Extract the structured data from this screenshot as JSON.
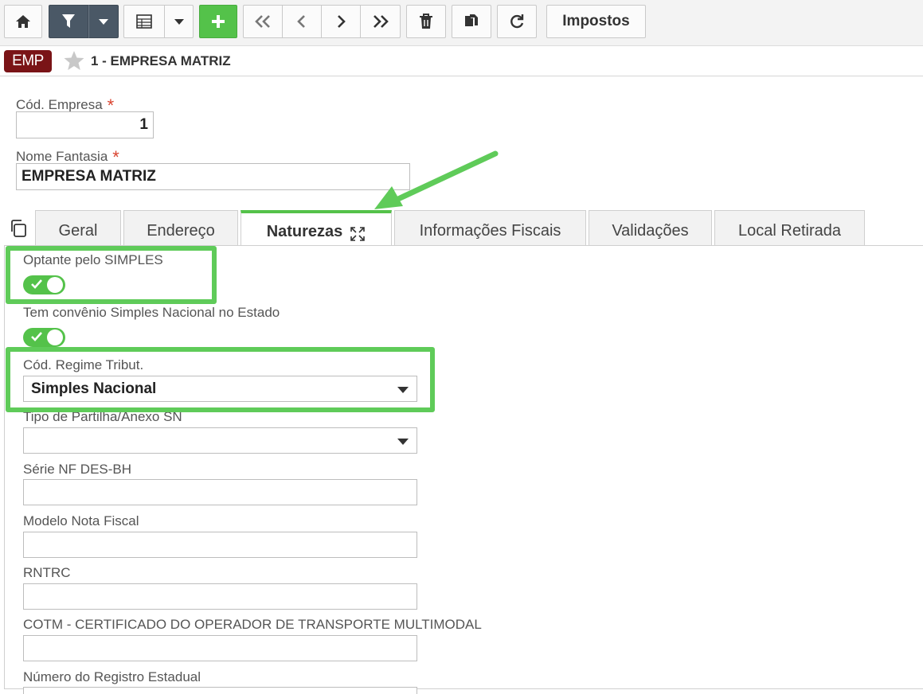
{
  "toolbar": {
    "buttons": [
      {
        "name": "home-button",
        "icon": "home-icon"
      },
      {
        "name": "filter-button",
        "icon": "filter-icon"
      },
      {
        "name": "filter-dropdown-button",
        "icon": "caret-down-icon"
      },
      {
        "name": "grid-view-button",
        "icon": "table-icon"
      },
      {
        "name": "grid-dropdown-button",
        "icon": "caret-down-icon"
      },
      {
        "name": "add-button",
        "icon": "plus-icon"
      },
      {
        "name": "first-record-button",
        "icon": "double-chevron-left-icon"
      },
      {
        "name": "previous-record-button",
        "icon": "chevron-left-icon"
      },
      {
        "name": "next-record-button",
        "icon": "chevron-right-icon"
      },
      {
        "name": "last-record-button",
        "icon": "double-chevron-right-icon"
      },
      {
        "name": "delete-button",
        "icon": "trash-icon"
      },
      {
        "name": "duplicate-button",
        "icon": "copy-icon"
      },
      {
        "name": "refresh-button",
        "icon": "refresh-icon"
      }
    ],
    "impostos_label": "Impostos"
  },
  "titlebar": {
    "badge": "EMP",
    "title": "1 - EMPRESA MATRIZ"
  },
  "form": {
    "cod_empresa_label": "Cód. Empresa",
    "cod_empresa_value": "1",
    "nome_fantasia_label": "Nome Fantasia",
    "nome_fantasia_value": "EMPRESA MATRIZ",
    "required_mark": "*"
  },
  "tabs": [
    {
      "label": "Geral",
      "active": false
    },
    {
      "label": "Endereço",
      "active": false
    },
    {
      "label": "Naturezas",
      "active": true
    },
    {
      "label": "Informações Fiscais",
      "active": false
    },
    {
      "label": "Validações",
      "active": false
    },
    {
      "label": "Local Retirada",
      "active": false
    }
  ],
  "naturezas": {
    "optante_simples_label": "Optante pelo SIMPLES",
    "optante_simples_on": true,
    "convenio_label": "Tem convênio Simples Nacional no Estado",
    "convenio_on": true,
    "regime_label": "Cód. Regime Tribut.",
    "regime_value": "Simples Nacional",
    "partilha_label": "Tipo de Partilha/Anexo SN",
    "partilha_value": "",
    "serie_label": "Série NF DES-BH",
    "serie_value": "",
    "modelo_label": "Modelo Nota Fiscal",
    "modelo_value": "",
    "rntrc_label": "RNTRC",
    "rntrc_value": "",
    "cotm_label": "COTM - CERTIFICADO DO OPERADOR DE TRANSPORTE MULTIMODAL",
    "cotm_value": "",
    "registro_label": "Número do Registro Estadual"
  },
  "colors": {
    "accent_green": "#54c24a",
    "highlight_green": "#5fcb59",
    "badge_red": "#7a1417",
    "required_red": "#d9432f",
    "dark_button": "#4a5866"
  }
}
